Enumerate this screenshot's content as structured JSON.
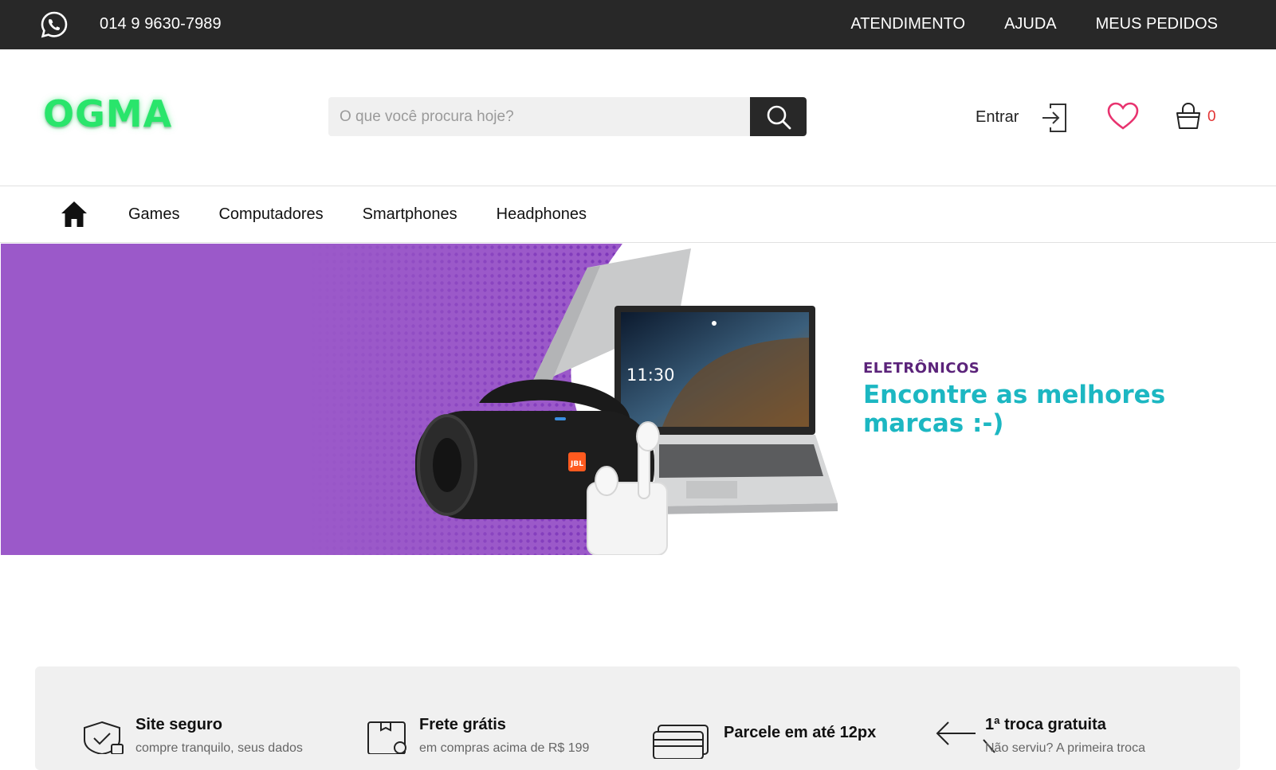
{
  "topbar": {
    "phone": "014 9 9630-7989",
    "links": [
      "ATENDIMENTO",
      "AJUDA",
      "MEUS PEDIDOS"
    ]
  },
  "header": {
    "logo_text": "OGMA",
    "search_placeholder": "O que você procura hoje?",
    "login_label": "Entrar",
    "cart_count": "0"
  },
  "nav": {
    "items": [
      "Games",
      "Computadores",
      "Smartphones",
      "Headphones"
    ]
  },
  "banner": {
    "kicker": "ELETRÔNICOS",
    "title": "Encontre as melhores marcas :-)",
    "laptop_time": "11:30",
    "speaker_brand": "JBL"
  },
  "features": [
    {
      "title": "Site seguro",
      "text": "compre tranquilo, seus dados"
    },
    {
      "title": "Frete grátis",
      "text": "em compras acima de R$ 199"
    },
    {
      "title": "Parcele em até 12px",
      "text": ""
    },
    {
      "title": "1ª troca gratuita",
      "text": "Não serviu? A primeira troca"
    }
  ],
  "colors": {
    "topbar_bg": "#282828",
    "logo": "#29e56b",
    "banner_purple": "#9b59c9",
    "banner_kicker": "#5b237a",
    "banner_title": "#1cb7c2",
    "heart": "#e8336f",
    "cart_count": "#e23434",
    "features_bg": "#f0f0f0"
  },
  "icons": {
    "contact": "whatsapp-icon",
    "search": "search-icon",
    "login": "login-icon",
    "wishlist": "heart-icon",
    "cart": "shopping-basket-icon",
    "home": "home-icon",
    "features": [
      "shield-check-icon",
      "box-icon",
      "cards-icon",
      "arrows-exchange-icon"
    ]
  }
}
